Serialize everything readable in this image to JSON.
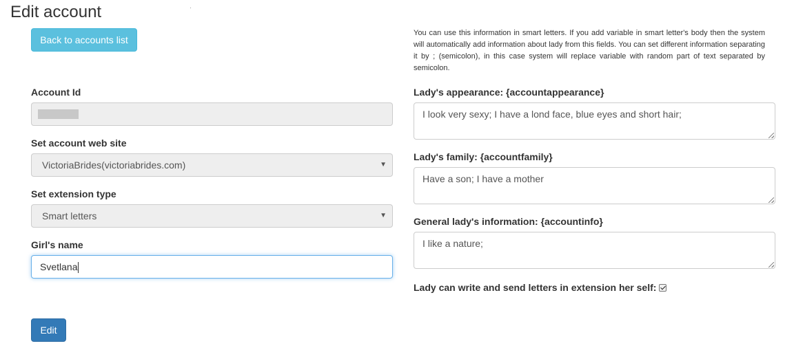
{
  "page": {
    "title": "Edit account"
  },
  "buttons": {
    "back": "Back to accounts list",
    "edit": "Edit"
  },
  "help_text": "You can use this information in smart letters. If you add variable in smart letter's body then the system will automatically add information about lady from this fields. You can set different information separating it by ; (semicolon), in this case system will replace variable with random part of text separated by semicolon.",
  "left_form": {
    "account_id": {
      "label": "Account Id",
      "value": ""
    },
    "web_site": {
      "label": "Set account web site",
      "value": "VictoriaBrides(victoriabrides.com)"
    },
    "extension_type": {
      "label": "Set extension type",
      "value": "Smart letters"
    },
    "girls_name": {
      "label": "Girl's name",
      "value": "Svetlana"
    }
  },
  "right_form": {
    "appearance": {
      "label": "Lady's appearance: {accountappearance}",
      "value": "I look very sexy; I have a lond face, blue eyes and short hair;"
    },
    "family": {
      "label": "Lady's family: {accountfamily}",
      "value": "Have a son; I have a mother"
    },
    "info": {
      "label": "General lady's information: {accountinfo}",
      "value": "I like a nature;"
    },
    "self_write": {
      "label": "Lady can write and send letters in extension her self:",
      "checked": true
    }
  },
  "colors": {
    "info_button": "#5bc0de",
    "primary_button": "#337ab7",
    "focus_border": "#66afe9"
  },
  "icons": {
    "select_caret": "caret-down-icon",
    "checkbox": "checked-checkbox-icon"
  }
}
